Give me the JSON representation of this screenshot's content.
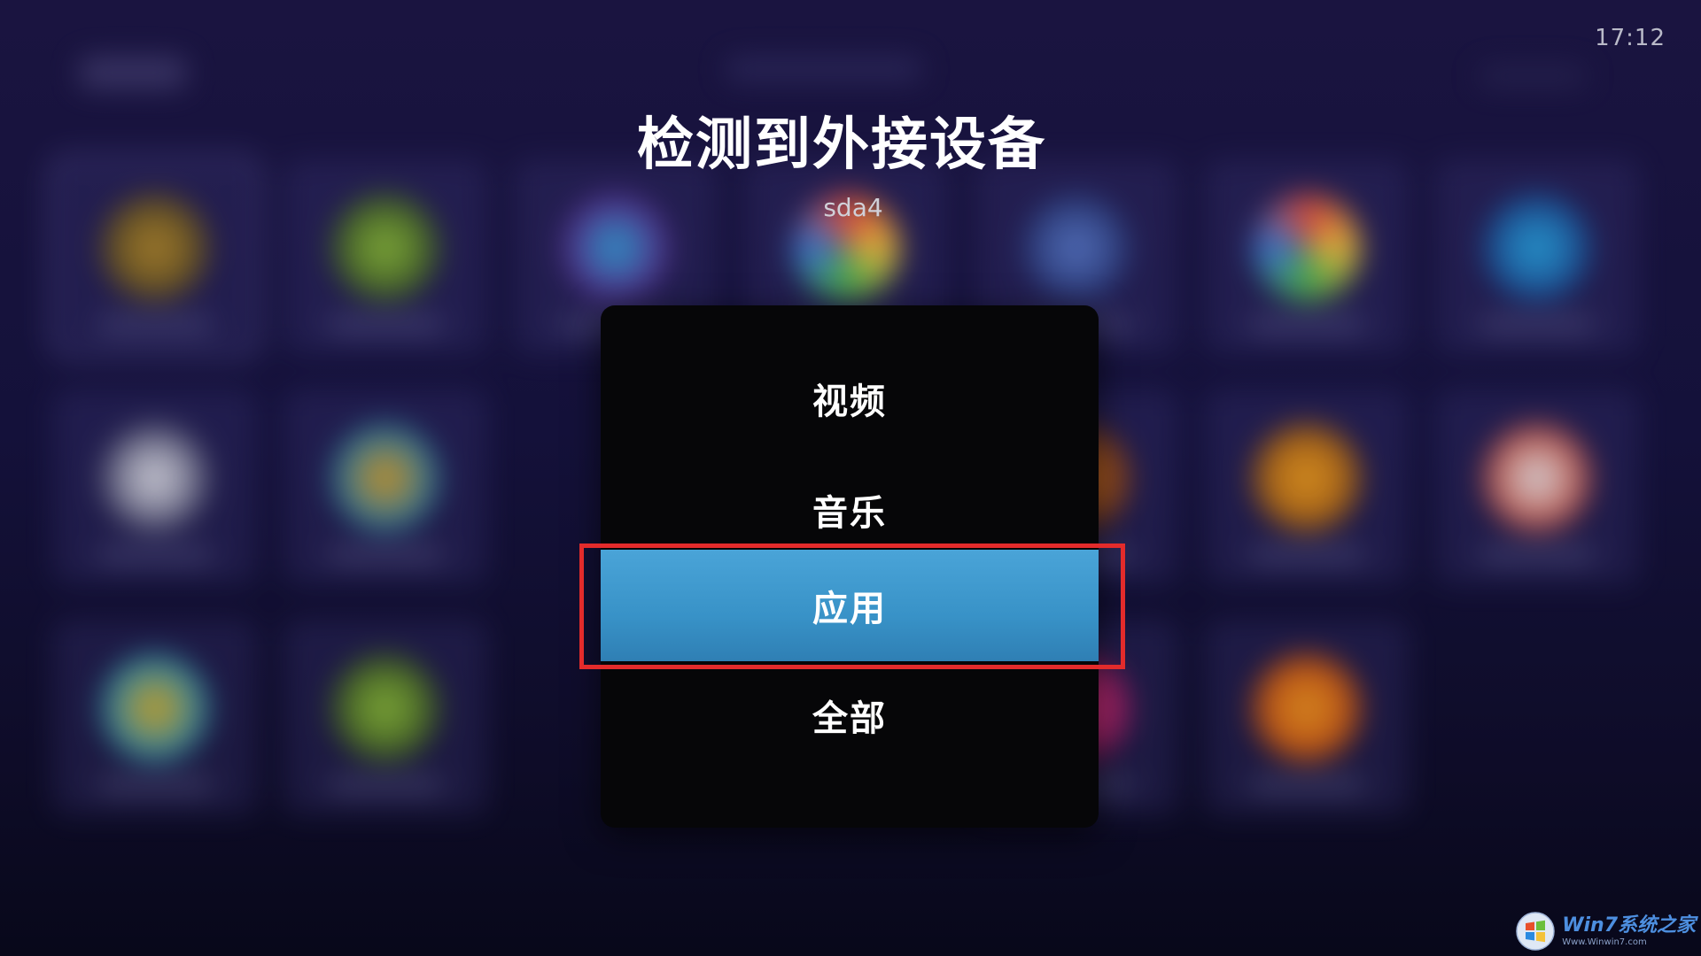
{
  "status_bar": {
    "clock": "17:12"
  },
  "dialog": {
    "title": "检测到外接设备",
    "device_name": "sda4"
  },
  "menu": {
    "items": [
      {
        "label": "视频",
        "selected": false
      },
      {
        "label": "音乐",
        "selected": false
      },
      {
        "label": "应用",
        "selected": true
      },
      {
        "label": "全部",
        "selected": false
      }
    ]
  },
  "colors": {
    "selected_item": "#3892c7",
    "highlight_border": "#e32b2b",
    "panel_background": "#060608"
  },
  "watermark": {
    "brand": "Win7系统之家",
    "sub": "Www.Winwin7.com"
  }
}
